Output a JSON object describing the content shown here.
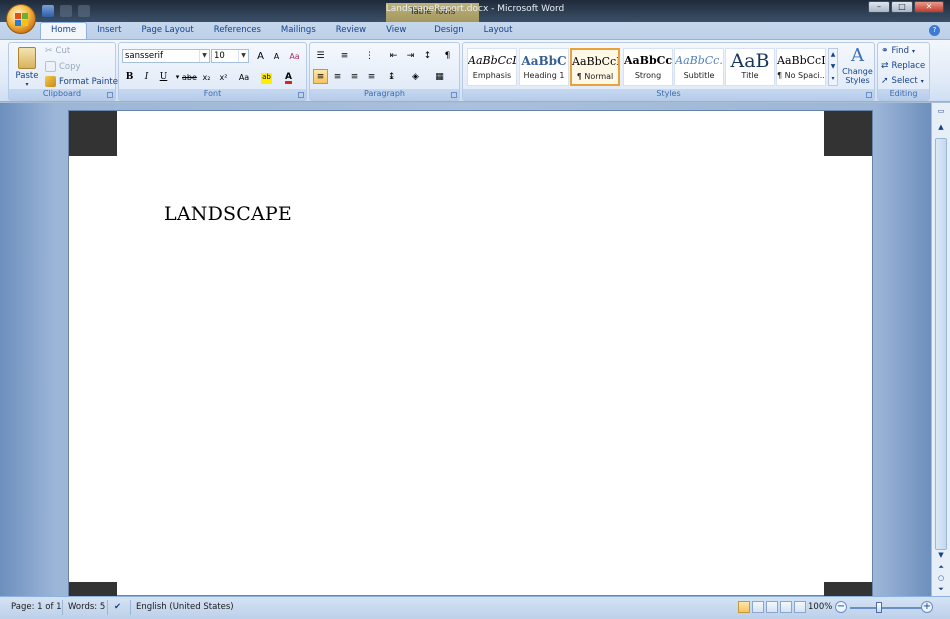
{
  "window": {
    "title": "LandscapeReport.docx - Microsoft Word",
    "context_tab_group": "Table Tools",
    "minimize": "–",
    "maximize": "□",
    "close": "✕"
  },
  "tabs": [
    {
      "label": "Home",
      "active": true
    },
    {
      "label": "Insert"
    },
    {
      "label": "Page Layout"
    },
    {
      "label": "References"
    },
    {
      "label": "Mailings"
    },
    {
      "label": "Review"
    },
    {
      "label": "View"
    },
    {
      "label": "Design"
    },
    {
      "label": "Layout"
    }
  ],
  "clipboard": {
    "group_label": "Clipboard",
    "paste": "Paste",
    "cut": "Cut",
    "copy": "Copy",
    "format_painter": "Format Painter"
  },
  "font": {
    "group_label": "Font",
    "font_name": "sansserif",
    "font_size": "10",
    "bold": "B",
    "italic": "I",
    "underline": "U",
    "strikethrough": "abe",
    "subscript": "x₂",
    "superscript": "x²",
    "change_case": "Aa",
    "grow": "A",
    "shrink": "A",
    "font_color": "A",
    "font_color_hex": "#e02020",
    "highlight_hex": "#ffee00"
  },
  "paragraph": {
    "group_label": "Paragraph",
    "pilcrow": "¶"
  },
  "styles": {
    "group_label": "Styles",
    "items": [
      {
        "sample": "AaBbCcL",
        "name": "Emphasis"
      },
      {
        "sample": "AaBbC",
        "name": "Heading 1"
      },
      {
        "sample": "AaBbCcI",
        "name": "¶ Normal",
        "selected": true
      },
      {
        "sample": "AaBbCcl",
        "name": "Strong"
      },
      {
        "sample": "AaBbCc.",
        "name": "Subtitle"
      },
      {
        "sample": "AaB",
        "name": "Title"
      },
      {
        "sample": "AaBbCcI",
        "name": "¶ No Spaci..."
      }
    ],
    "change_styles_line1": "Change",
    "change_styles_line2": "Styles"
  },
  "editing": {
    "group_label": "Editing",
    "find": "Find",
    "replace": "Replace",
    "select": "Select"
  },
  "document": {
    "text": "LANDSCAPE"
  },
  "status": {
    "page": "Page: 1 of 1",
    "words": "Words: 5",
    "language": "English (United States)",
    "zoom": "100%",
    "zoom_minus": "−",
    "zoom_plus": "+"
  }
}
